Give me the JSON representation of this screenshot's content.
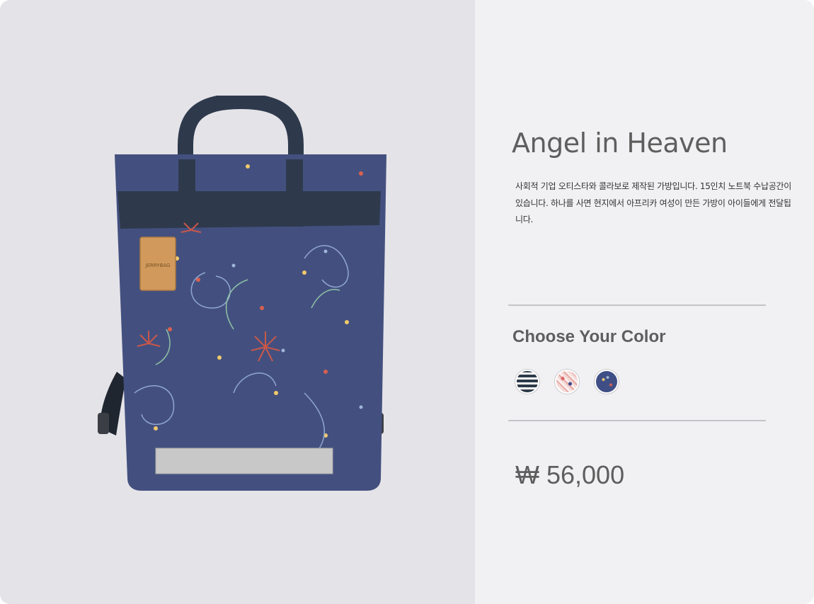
{
  "product": {
    "title": "Angel in Heaven",
    "description": "사회적 기업 오티스타와 콜라보로 제작된 가방입니다. 15인치 노트북 수납공간이 있습니다. 하나를 사면 현지에서 아프리카 여성이 만든 가방이 아이들에게 전달됩니다.",
    "brand_patch": "JERRYBAG",
    "price": "₩ 56,000"
  },
  "color_picker": {
    "heading": "Choose Your Color",
    "options": [
      {
        "name": "navy-stripe",
        "color": "#2d3a48"
      },
      {
        "name": "pink-pattern",
        "color": "#e7a9a3"
      },
      {
        "name": "blue-pattern",
        "color": "#3f4f86"
      }
    ]
  },
  "colors": {
    "image_panel_bg": "#e4e3e8",
    "info_panel_bg": "#f1f1f3",
    "heading_text": "#5f5e5e",
    "bag_body": "#43507f",
    "bag_strap": "#2e3a4c",
    "patch": "#d19a5c"
  }
}
